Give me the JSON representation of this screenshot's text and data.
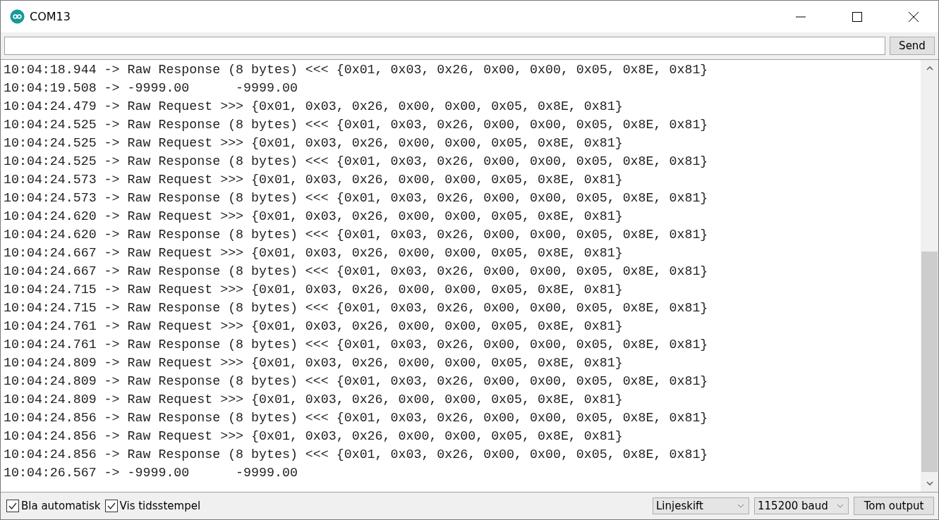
{
  "window": {
    "title": "COM13"
  },
  "send_bar": {
    "button": "Send"
  },
  "output_lines": [
    "10:04:18.944 -> Raw Response (8 bytes) <<< {0x01, 0x03, 0x26, 0x00, 0x00, 0x05, 0x8E, 0x81}",
    "10:04:19.508 -> -9999.00      -9999.00",
    "10:04:24.479 -> Raw Request >>> {0x01, 0x03, 0x26, 0x00, 0x00, 0x05, 0x8E, 0x81}",
    "10:04:24.525 -> Raw Response (8 bytes) <<< {0x01, 0x03, 0x26, 0x00, 0x00, 0x05, 0x8E, 0x81}",
    "10:04:24.525 -> Raw Request >>> {0x01, 0x03, 0x26, 0x00, 0x00, 0x05, 0x8E, 0x81}",
    "10:04:24.525 -> Raw Response (8 bytes) <<< {0x01, 0x03, 0x26, 0x00, 0x00, 0x05, 0x8E, 0x81}",
    "10:04:24.573 -> Raw Request >>> {0x01, 0x03, 0x26, 0x00, 0x00, 0x05, 0x8E, 0x81}",
    "10:04:24.573 -> Raw Response (8 bytes) <<< {0x01, 0x03, 0x26, 0x00, 0x00, 0x05, 0x8E, 0x81}",
    "10:04:24.620 -> Raw Request >>> {0x01, 0x03, 0x26, 0x00, 0x00, 0x05, 0x8E, 0x81}",
    "10:04:24.620 -> Raw Response (8 bytes) <<< {0x01, 0x03, 0x26, 0x00, 0x00, 0x05, 0x8E, 0x81}",
    "10:04:24.667 -> Raw Request >>> {0x01, 0x03, 0x26, 0x00, 0x00, 0x05, 0x8E, 0x81}",
    "10:04:24.667 -> Raw Response (8 bytes) <<< {0x01, 0x03, 0x26, 0x00, 0x00, 0x05, 0x8E, 0x81}",
    "10:04:24.715 -> Raw Request >>> {0x01, 0x03, 0x26, 0x00, 0x00, 0x05, 0x8E, 0x81}",
    "10:04:24.715 -> Raw Response (8 bytes) <<< {0x01, 0x03, 0x26, 0x00, 0x00, 0x05, 0x8E, 0x81}",
    "10:04:24.761 -> Raw Request >>> {0x01, 0x03, 0x26, 0x00, 0x00, 0x05, 0x8E, 0x81}",
    "10:04:24.761 -> Raw Response (8 bytes) <<< {0x01, 0x03, 0x26, 0x00, 0x00, 0x05, 0x8E, 0x81}",
    "10:04:24.809 -> Raw Request >>> {0x01, 0x03, 0x26, 0x00, 0x00, 0x05, 0x8E, 0x81}",
    "10:04:24.809 -> Raw Response (8 bytes) <<< {0x01, 0x03, 0x26, 0x00, 0x00, 0x05, 0x8E, 0x81}",
    "10:04:24.809 -> Raw Request >>> {0x01, 0x03, 0x26, 0x00, 0x00, 0x05, 0x8E, 0x81}",
    "10:04:24.856 -> Raw Response (8 bytes) <<< {0x01, 0x03, 0x26, 0x00, 0x00, 0x05, 0x8E, 0x81}",
    "10:04:24.856 -> Raw Request >>> {0x01, 0x03, 0x26, 0x00, 0x00, 0x05, 0x8E, 0x81}",
    "10:04:24.856 -> Raw Response (8 bytes) <<< {0x01, 0x03, 0x26, 0x00, 0x00, 0x05, 0x8E, 0x81}",
    "10:04:26.567 -> -9999.00      -9999.00"
  ],
  "options": [
    {
      "label": "Bla automatisk",
      "checked": true
    },
    {
      "label": "Vis tidsstempel",
      "checked": true
    }
  ],
  "line_ending": "Linjeskift",
  "baud_rate": "115200 baud",
  "clear_button": "Tom output"
}
